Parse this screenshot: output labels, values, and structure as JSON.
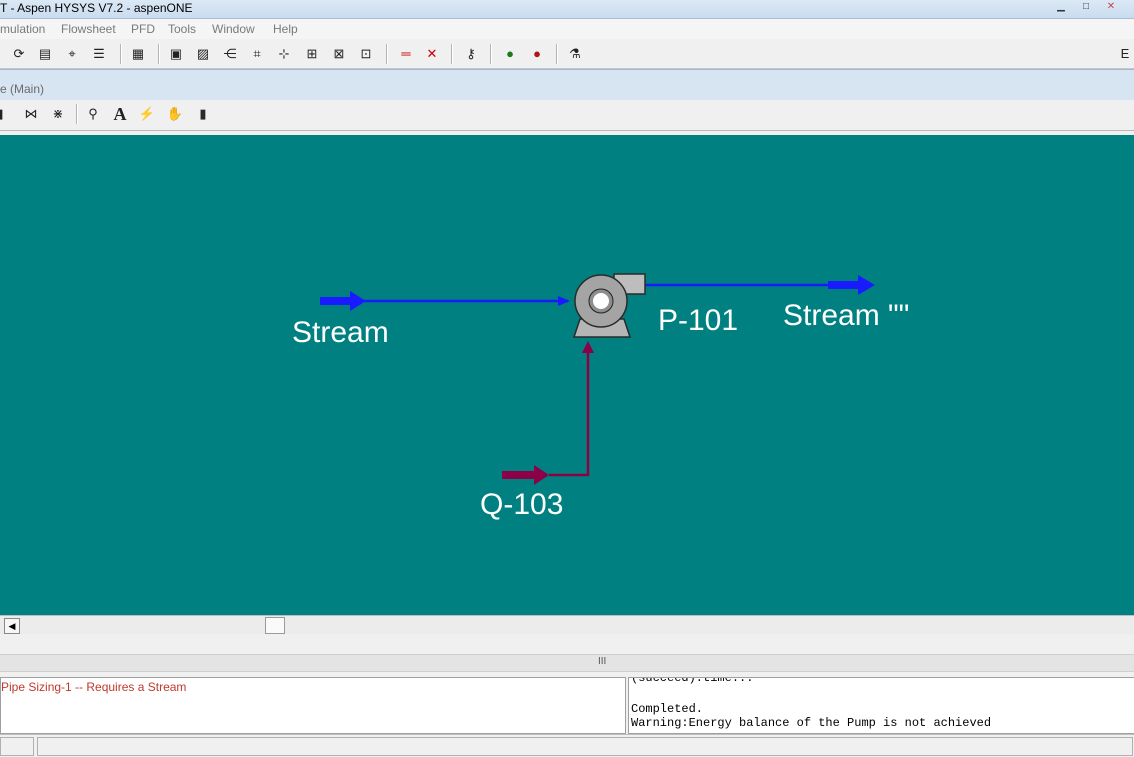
{
  "window": {
    "title": "T - Aspen HYSYS V7.2 - aspenONE",
    "corner_label": "E"
  },
  "menu": [
    "mulation",
    "Flowsheet",
    "PFD",
    "Tools",
    "Window",
    "Help"
  ],
  "toolbar_main": {
    "icons": [
      "recycle-icon",
      "workbook-icon",
      "binoculars-icon",
      "component-list-icon",
      "grid-icon",
      "pfd-icon",
      "data-recorder-icon",
      "mixer-icon",
      "connect-icon",
      "tree-icon",
      "spreadsheet-icon",
      "case-study-icon",
      "optimizer-icon",
      "red-line-icon",
      "crossing-streams-icon",
      "key-icon",
      "pump-green-icon",
      "pump-red-icon",
      "flask-icon"
    ]
  },
  "pfd_window": {
    "title": "e (Main)",
    "toolbar_icons": [
      "break-icon",
      "attach-icon",
      "split-icon",
      "zoom-icon",
      "text-icon",
      "lightning-icon",
      "pan-icon",
      "traffic-light-icon"
    ]
  },
  "flowsheet": {
    "background": "#008080",
    "material_stream_color": "#1a1aff",
    "energy_stream_color": "#8b0047",
    "label_color": "#ffffff",
    "labels": {
      "inlet": "Stream",
      "outlet": "Stream \"\"",
      "pump": "P-101",
      "energy": "Q-103"
    }
  },
  "status": {
    "left_message": "Pipe Sizing-1 -- Requires a Stream",
    "right_lines": [
      "(succeed).time...",
      "Completed.",
      "Warning:Energy balance of the Pump is not achieved"
    ]
  }
}
